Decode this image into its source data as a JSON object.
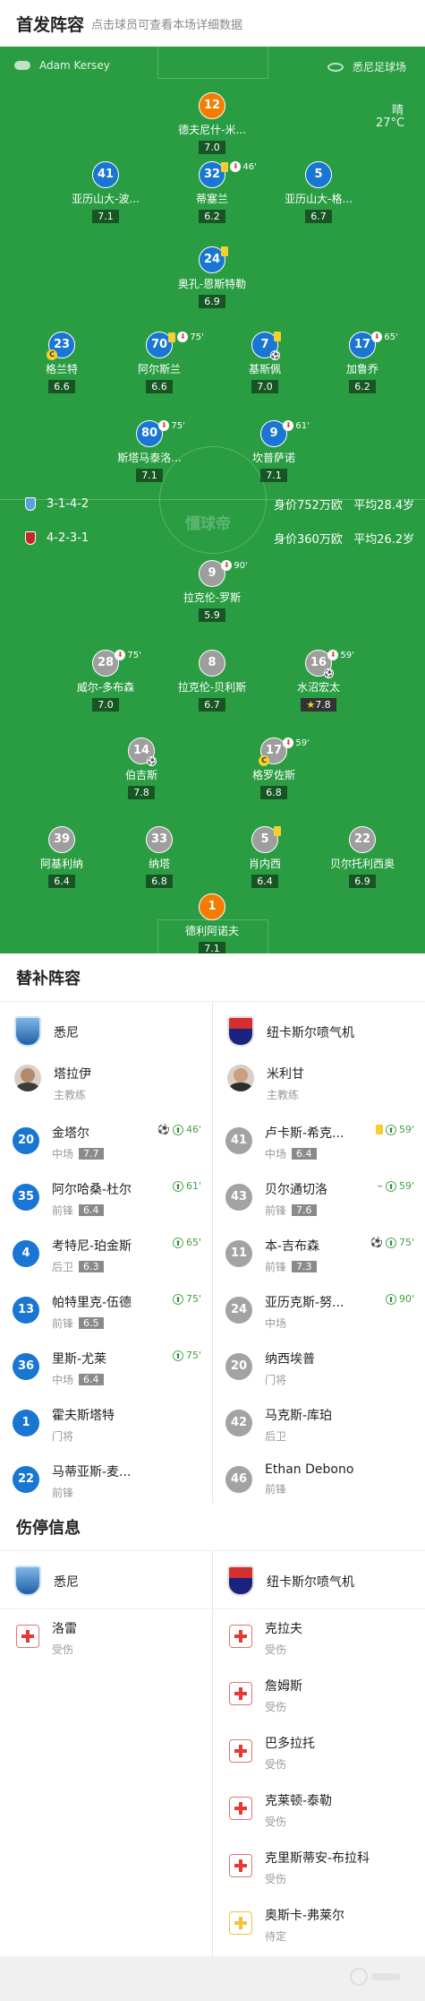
{
  "header": {
    "title": "首发阵容",
    "subtitle": "点击球员可查看本场详细数据"
  },
  "pitch": {
    "referee": "Adam Kersey",
    "stadium": "悉尼足球场",
    "weather": "晴",
    "temperature": "27°C",
    "watermark": "懂球帝"
  },
  "home_team": {
    "formation": "3-1-4-2",
    "value": "身价752万欧",
    "avg_age": "平均28.4岁"
  },
  "away_team": {
    "formation": "4-2-3-1",
    "value": "身价360万欧",
    "avg_age": "平均26.2岁"
  },
  "home_lineup": [
    {
      "num": "12",
      "name": "德夫尼什-米...",
      "rating": "7.0",
      "kit": "orange"
    },
    {
      "num": "41",
      "name": "亚历山大-波...",
      "rating": "7.1",
      "kit": "blue"
    },
    {
      "num": "32",
      "name": "蒂塞兰",
      "rating": "6.2",
      "kit": "blue",
      "event": "46'",
      "yellow": true,
      "sub": true
    },
    {
      "num": "5",
      "name": "亚历山大-格...",
      "rating": "6.7",
      "kit": "blue"
    },
    {
      "num": "24",
      "name": "奥孔-恩斯特勒",
      "rating": "6.9",
      "kit": "blue",
      "yellow": true
    },
    {
      "num": "23",
      "name": "格兰特",
      "rating": "6.6",
      "kit": "blue",
      "captain": true
    },
    {
      "num": "70",
      "name": "阿尔斯兰",
      "rating": "6.6",
      "kit": "blue",
      "event": "75'",
      "yellow": true,
      "sub": true
    },
    {
      "num": "7",
      "name": "基斯佩",
      "rating": "7.0",
      "kit": "blue",
      "yellow": true,
      "ball": true
    },
    {
      "num": "17",
      "name": "加鲁乔",
      "rating": "6.2",
      "kit": "blue",
      "event": "65'",
      "sub": true
    },
    {
      "num": "80",
      "name": "斯塔马泰洛...",
      "rating": "7.1",
      "kit": "blue",
      "event": "75'",
      "sub": true
    },
    {
      "num": "9",
      "name": "坎普萨诺",
      "rating": "7.1",
      "kit": "blue",
      "event": "61'",
      "sub": true
    }
  ],
  "away_lineup": [
    {
      "num": "9",
      "name": "拉克伦-罗斯",
      "rating": "5.9",
      "kit": "gray",
      "event": "90'",
      "sub": true
    },
    {
      "num": "28",
      "name": "威尔-多布森",
      "rating": "7.0",
      "kit": "gray",
      "event": "75'",
      "sub": true
    },
    {
      "num": "8",
      "name": "拉克伦-贝利斯",
      "rating": "6.7",
      "kit": "gray"
    },
    {
      "num": "16",
      "name": "水沼宏太",
      "rating": "7.8",
      "kit": "gray",
      "event": "59'",
      "sub": true,
      "ball": true,
      "best": true,
      "star": "★"
    },
    {
      "num": "14",
      "name": "伯吉斯",
      "rating": "7.8",
      "kit": "gray",
      "ball": true
    },
    {
      "num": "17",
      "name": "格罗佐斯",
      "rating": "6.8",
      "kit": "gray",
      "event": "59'",
      "sub": true,
      "captain": true
    },
    {
      "num": "39",
      "name": "阿基利纳",
      "rating": "6.4",
      "kit": "gray"
    },
    {
      "num": "33",
      "name": "纳塔",
      "rating": "6.8",
      "kit": "gray"
    },
    {
      "num": "5",
      "name": "肖内西",
      "rating": "6.4",
      "kit": "gray",
      "yellow": true
    },
    {
      "num": "22",
      "name": "贝尔托利西奥",
      "rating": "6.9",
      "kit": "gray"
    },
    {
      "num": "1",
      "name": "德利阿诺夫",
      "rating": "7.1",
      "kit": "orange"
    }
  ],
  "subs": {
    "title": "替补阵容",
    "home_name": "悉尼",
    "away_name": "纽卡斯尔喷气机",
    "home_coach": {
      "name": "塔拉伊",
      "role": "主教练"
    },
    "away_coach": {
      "name": "米利甘",
      "role": "主教练"
    },
    "home": [
      {
        "num": "20",
        "name": "金塔尔",
        "pos": "中场",
        "rating": "7.7",
        "event": "46'",
        "ball": true,
        "in": true
      },
      {
        "num": "35",
        "name": "阿尔哈桑-杜尔",
        "pos": "前锋",
        "rating": "6.4",
        "event": "61'",
        "in": true
      },
      {
        "num": "4",
        "name": "考特尼-珀金斯",
        "pos": "后卫",
        "rating": "6.3",
        "event": "65'",
        "in": true
      },
      {
        "num": "13",
        "name": "帕特里克-伍德",
        "pos": "前锋",
        "rating": "6.5",
        "event": "75'",
        "in": true
      },
      {
        "num": "36",
        "name": "里斯-尤莱",
        "pos": "中场",
        "rating": "6.4",
        "event": "75'",
        "in": true
      },
      {
        "num": "1",
        "name": "霍夫斯塔特",
        "pos": "门将"
      },
      {
        "num": "22",
        "name": "马蒂亚斯-麦...",
        "pos": "前锋"
      }
    ],
    "away": [
      {
        "num": "41",
        "name": "卢卡斯-希克...",
        "pos": "中场",
        "rating": "6.4",
        "event": "59'",
        "yellow": true,
        "in": true
      },
      {
        "num": "43",
        "name": "贝尔通切洛",
        "pos": "前锋",
        "rating": "7.6",
        "event": "59'",
        "boot": true,
        "in": true
      },
      {
        "num": "11",
        "name": "本-吉布森",
        "pos": "前锋",
        "rating": "7.3",
        "event": "75'",
        "ball": true,
        "in": true
      },
      {
        "num": "24",
        "name": "亚历克斯-努...",
        "pos": "中场",
        "event": "90'",
        "in": true
      },
      {
        "num": "20",
        "name": "纳西埃普",
        "pos": "门将"
      },
      {
        "num": "42",
        "name": "马克斯-库珀",
        "pos": "后卫"
      },
      {
        "num": "46",
        "name": "Ethan Debono",
        "pos": "前锋"
      }
    ]
  },
  "injuries": {
    "title": "伤停信息",
    "home_name": "悉尼",
    "away_name": "纽卡斯尔喷气机",
    "home": [
      {
        "name": "洛雷",
        "status": "受伤"
      }
    ],
    "away": [
      {
        "name": "克拉夫",
        "status": "受伤"
      },
      {
        "name": "詹姆斯",
        "status": "受伤"
      },
      {
        "name": "巴多拉托",
        "status": "受伤"
      },
      {
        "name": "克莱顿-泰勒",
        "status": "受伤"
      },
      {
        "name": "克里斯蒂安-布拉科",
        "status": "受伤"
      },
      {
        "name": "奥斯卡-弗莱尔",
        "status": "待定"
      }
    ]
  },
  "colors": {
    "pitch": "#2a9d42",
    "home_kit": "#1976d2",
    "away_kit": "#9e9e9e",
    "gk_kit": "#f57c00"
  }
}
